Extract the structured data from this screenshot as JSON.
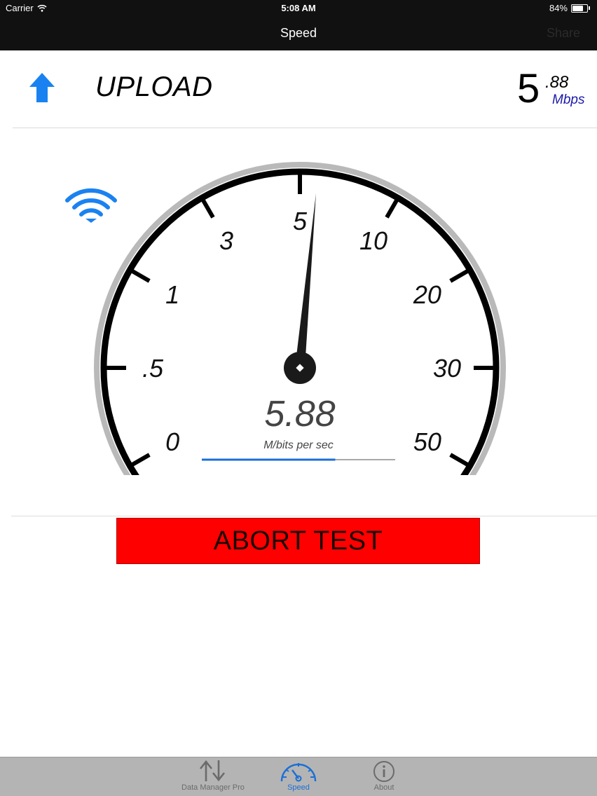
{
  "status_bar": {
    "carrier": "Carrier",
    "time": "5:08 AM",
    "battery": "84%",
    "battery_level": 0.84
  },
  "nav": {
    "title": "Speed",
    "share_label": "Share"
  },
  "test": {
    "direction_label": "UPLOAD",
    "rate_whole": "5",
    "rate_fraction": ".88",
    "rate_unit": "Mbps"
  },
  "gauge": {
    "tick_labels": [
      "0",
      ".5",
      "1",
      "3",
      "5",
      "10",
      "20",
      "30",
      "50"
    ],
    "tick_values": [
      0,
      0.5,
      1,
      3,
      5,
      10,
      20,
      30,
      50
    ],
    "needle_value": 5.88,
    "readout": "5.88",
    "readout_unit": "M/bits per sec",
    "progress": 0.69,
    "accent_color": "#1a6fd6"
  },
  "actions": {
    "abort_label": "ABORT TEST",
    "abort_color": "#ff0000"
  },
  "tabs": [
    {
      "label": "Data Manager Pro",
      "icon": "transfer-arrows-icon",
      "active": false
    },
    {
      "label": "Speed",
      "icon": "speedometer-icon",
      "active": true
    },
    {
      "label": "About",
      "icon": "info-icon",
      "active": false
    }
  ]
}
